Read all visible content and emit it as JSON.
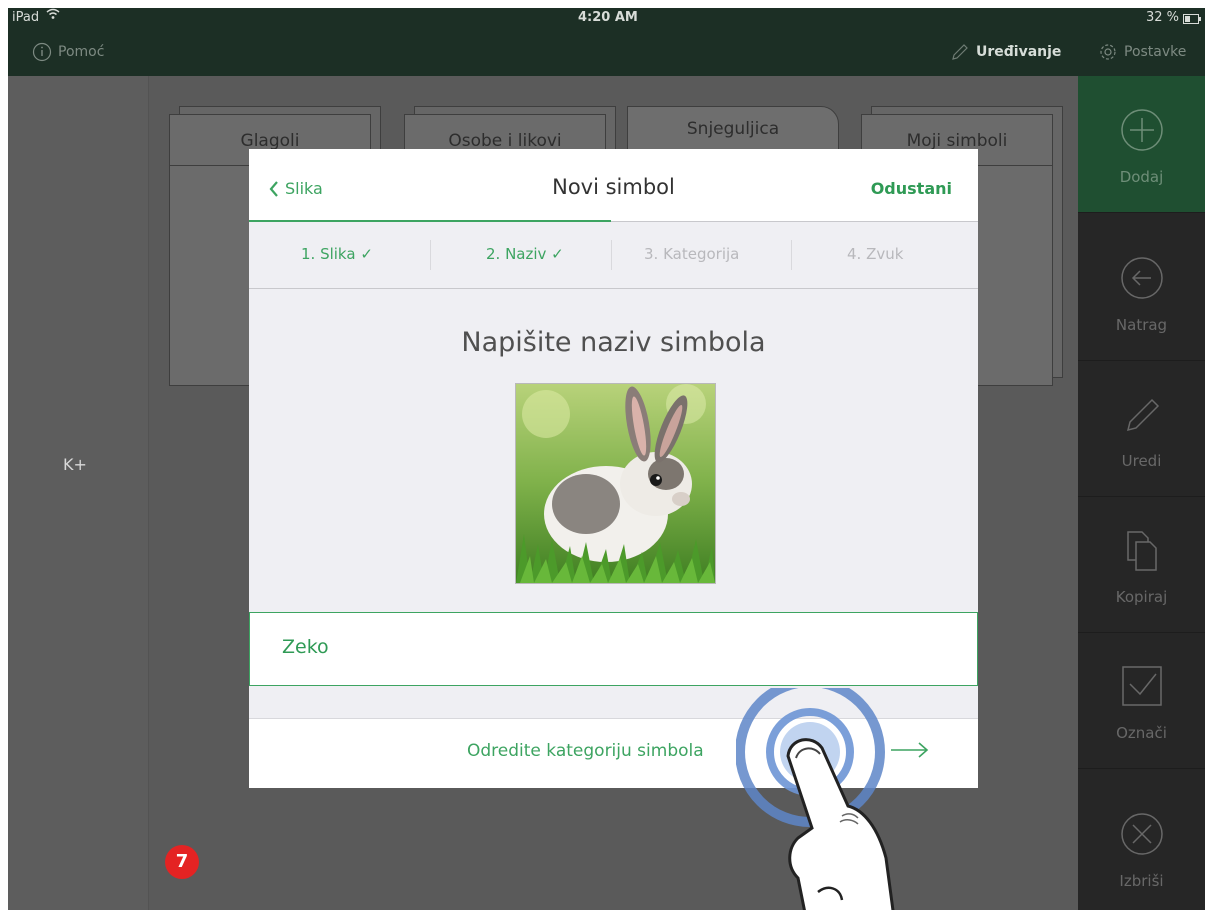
{
  "status": {
    "device": "iPad",
    "time": "4:20 AM",
    "battery": "32 %"
  },
  "topbar": {
    "help_label": "Pomoć",
    "edit_label": "Uređivanje",
    "settings_label": "Postavke"
  },
  "left": {
    "keyboard_label": "K+"
  },
  "folders": [
    {
      "label": "Glagoli"
    },
    {
      "label": "Osobe i likovi"
    },
    {
      "label": "Snjeguljica"
    },
    {
      "label": "Moji simboli"
    }
  ],
  "toolbar": {
    "add_label": "Dodaj",
    "back_label": "Natrag",
    "edit_label": "Uredi",
    "copy_label": "Kopiraj",
    "select_label": "Označi",
    "delete_label": "Izbriši"
  },
  "dialog": {
    "back_label": "Slika",
    "title": "Novi simbol",
    "cancel_label": "Odustani",
    "progress_fraction": 0.5,
    "steps": [
      {
        "label": "1. Slika ✓",
        "state": "done"
      },
      {
        "label": "2. Naziv ✓",
        "state": "done"
      },
      {
        "label": "3. Kategorija",
        "state": "pending"
      },
      {
        "label": "4. Zvuk",
        "state": "pending"
      }
    ],
    "heading": "Napišite naziv simbola",
    "image_subject": "rabbit-photo",
    "name_value": "Zeko",
    "next_label": "Odredite kategoriju simbola"
  },
  "badge": {
    "number": "7"
  },
  "colors": {
    "accent": "#3da461",
    "topbar": "#1c2f25",
    "badge": "#e42323"
  }
}
